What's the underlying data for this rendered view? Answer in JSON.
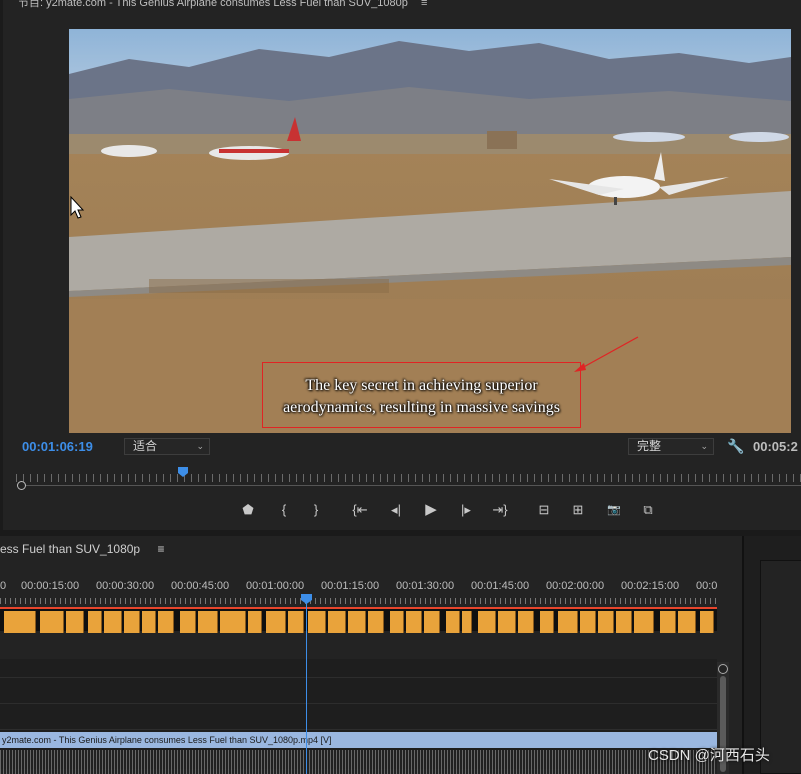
{
  "program_monitor": {
    "title": "节目: y2mate.com - This Genius Airplane consumes Less Fuel than SUV_1080p",
    "menu_icon": "≡",
    "subtitle_line1": "The key secret in achieving superior",
    "subtitle_line2": "aerodynamics, resulting in massive savings",
    "current_timecode": "00:01:06:19",
    "fit_dropdown": "适合",
    "quality_dropdown": "完整",
    "duration": "00:05:2",
    "playhead_progress": 0.2,
    "transport": {
      "marker": "⬟",
      "mark_in": "{",
      "mark_out": "}",
      "go_to_in": "{⇤",
      "step_back": "◂|",
      "play": "▶",
      "step_forward": "|▸",
      "go_to_out": "⇥}",
      "lift": "⊟",
      "extract": "⊞",
      "export_frame": "📷",
      "compare": "⧉"
    }
  },
  "timeline": {
    "title": "ess Fuel than SUV_1080p",
    "menu_icon": "≡",
    "ruler": [
      "0",
      "00:00:15:00",
      "00:00:30:00",
      "00:00:45:00",
      "00:01:00:00",
      "00:01:15:00",
      "00:01:30:00",
      "00:01:45:00",
      "00:02:00:00",
      "00:02:15:00",
      "00:0"
    ],
    "video_clip_label": "y2mate.com - This Genius Airplane consumes Less Fuel than SUV_1080p.mp4 [V]",
    "playhead_time": "00:01:06:19"
  },
  "watermark": "CSDN @河西石头",
  "colors": {
    "accent_blue": "#3d8ee8",
    "caption_clip": "#e9a33b",
    "video_clip": "#9ab7e0",
    "annotation_red": "#e02424"
  }
}
